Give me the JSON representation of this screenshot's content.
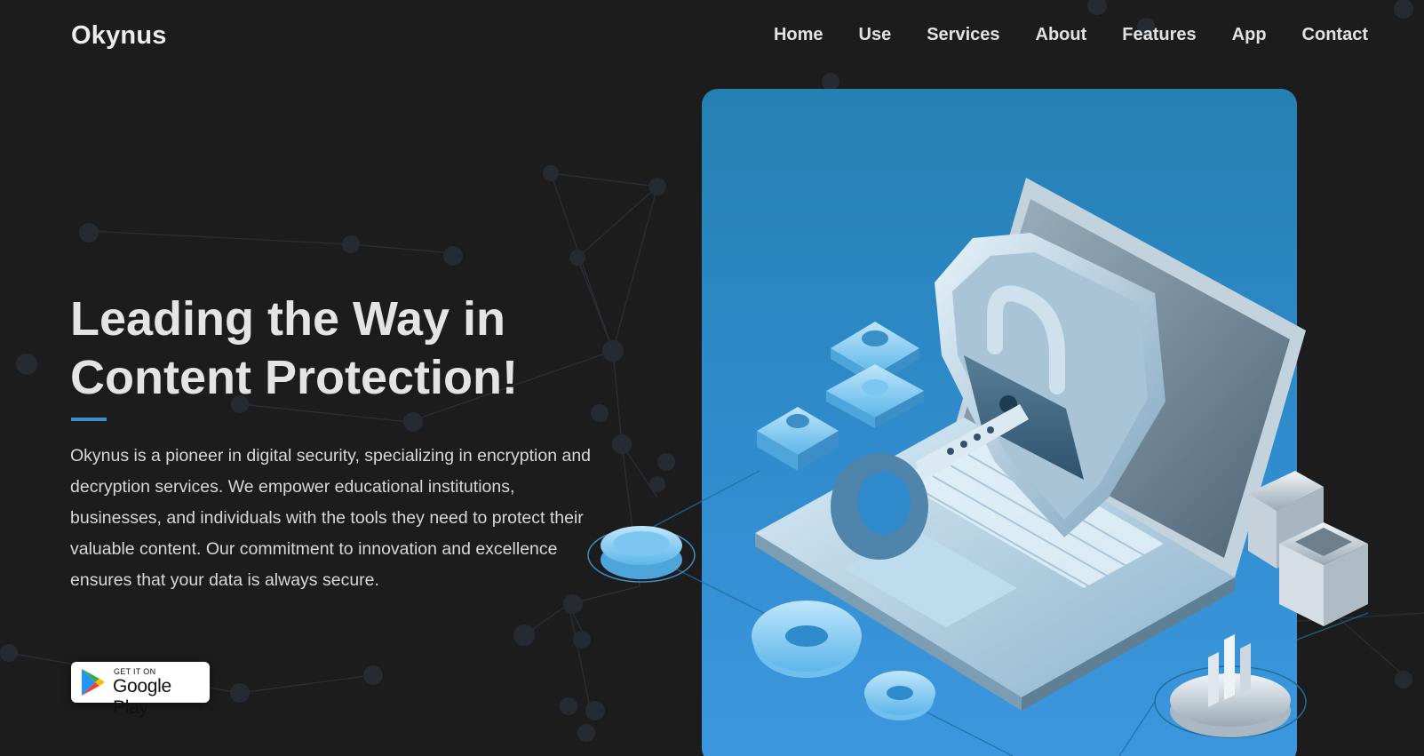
{
  "brand": {
    "name": "Okynus"
  },
  "nav": {
    "items": [
      {
        "label": "Home"
      },
      {
        "label": "Use"
      },
      {
        "label": "Services"
      },
      {
        "label": "About"
      },
      {
        "label": "Features"
      },
      {
        "label": "App"
      },
      {
        "label": "Contact"
      }
    ]
  },
  "hero": {
    "title_line1": "Leading the Way in",
    "title_line2": "Content Protection!",
    "description": "Okynus is a pioneer in digital security, specializing in encryption and decryption services. We empower educational institutions, businesses, and individuals with the tools they need to protect their valuable content. Our commitment to innovation and excellence ensures that your data is always secure.",
    "accent_color": "#3a8fcf"
  },
  "store_badge": {
    "small_text": "GET IT ON",
    "big_text": "Google Play",
    "icon": "google-play-icon"
  },
  "illustration": {
    "icons": [
      "laptop-icon",
      "shield-icon",
      "padlock-icon",
      "key-icon",
      "gear-icon",
      "server-stack-icon",
      "chip-icon",
      "bar-chart-icon"
    ],
    "card_color": "#2f8bcb"
  },
  "theme": {
    "background": "#1c1c1d",
    "text": "#e4e4e4"
  }
}
